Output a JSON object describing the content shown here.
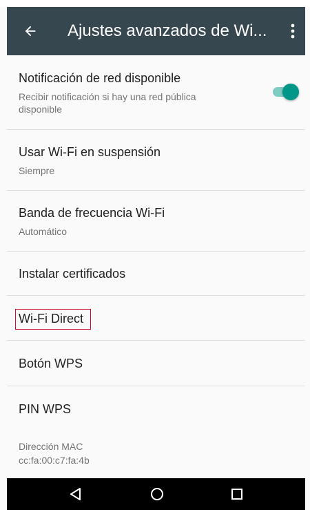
{
  "toolbar": {
    "title": "Ajustes avanzados de Wi..."
  },
  "settings": [
    {
      "title": "Notificación de red disponible",
      "summary_line1": "Recibir notificación si hay una red pública",
      "summary_line2": "disponible",
      "toggle_on": true
    },
    {
      "title": "Usar Wi-Fi en suspensión",
      "summary": "Siempre"
    },
    {
      "title": "Banda de frecuencia Wi-Fi",
      "summary": "Automático"
    },
    {
      "title": "Instalar certificados"
    },
    {
      "title": "Wi-Fi Direct"
    },
    {
      "title": "Botón WPS"
    },
    {
      "title": "PIN WPS"
    }
  ],
  "mac": {
    "label": "Dirección MAC",
    "value": "cc:fa:00:c7:fa:4b"
  },
  "colors": {
    "toolbar": "#37474f",
    "accent": "#009688",
    "highlight": "#c8102e"
  },
  "icons": {
    "back": "arrow-back-icon",
    "more": "more-vert-icon",
    "nav_back": "triangle-back-icon",
    "nav_home": "circle-home-icon",
    "nav_recents": "square-recents-icon"
  }
}
